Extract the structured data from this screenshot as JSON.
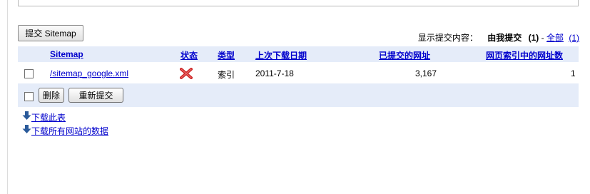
{
  "top_input": {
    "value": "网页索引中的网址"
  },
  "toolbar": {
    "submit_sitemap_label": "提交 Sitemap"
  },
  "filter": {
    "label": "显示提交内容：",
    "mine_label": "由我提交",
    "mine_count": "(1)",
    "separator": "-",
    "all_label": "全部",
    "all_count": "(1)"
  },
  "table": {
    "columns": [
      "Sitemap",
      "状态",
      "类型",
      "上次下载日期",
      "已提交的网址",
      "网页索引中的网址数"
    ],
    "rows": [
      {
        "sitemap": "/sitemap_google.xml",
        "status_icon": "error-x-icon",
        "type": "索引",
        "last_download": "2011-7-18",
        "submitted_urls": "3,167",
        "indexed_urls": "1"
      }
    ]
  },
  "actions": {
    "delete_label": "删除",
    "resubmit_label": "重新提交"
  },
  "downloads": {
    "download_table_label": "下载此表",
    "download_all_label": "下载所有网站的数据",
    "icon": "download-arrow-icon"
  },
  "colors": {
    "header_bg": "#e5ecf9",
    "link": "#0000cc",
    "error_icon": "#cc2222"
  }
}
